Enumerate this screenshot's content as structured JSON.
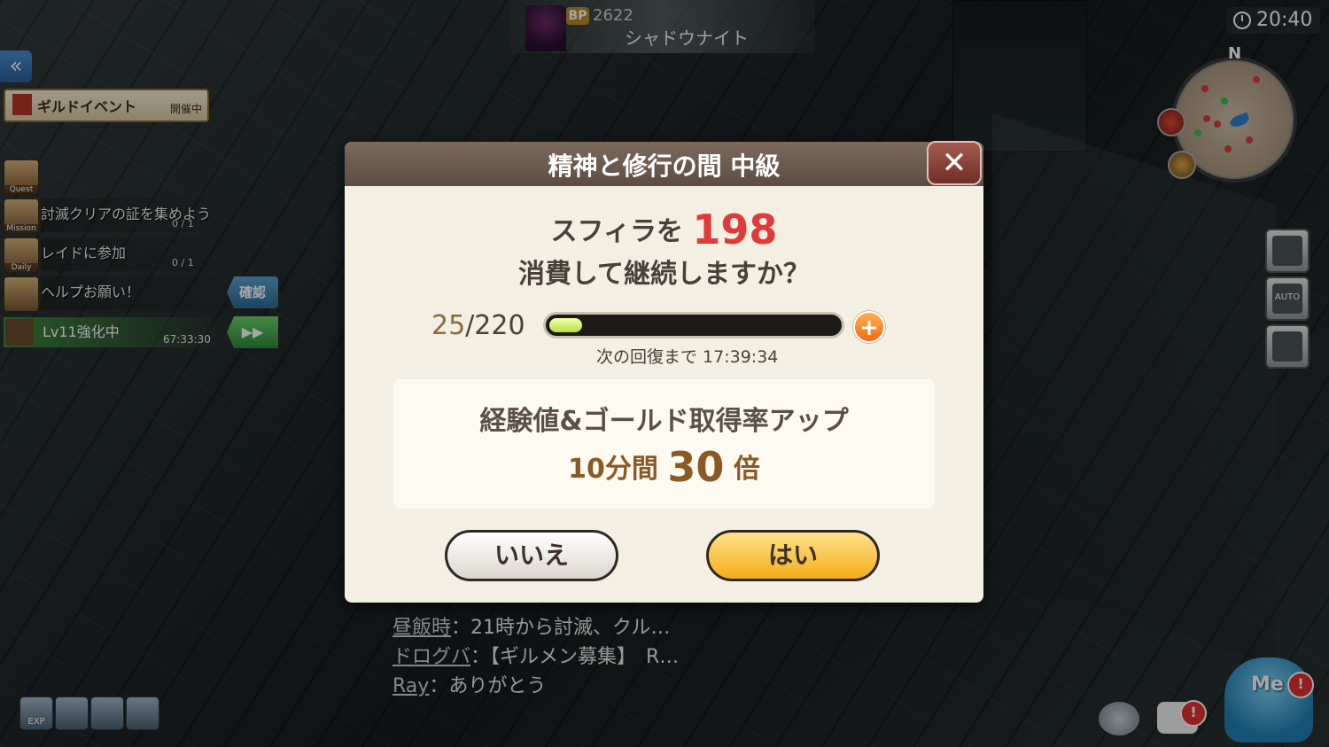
{
  "hud": {
    "target": {
      "bp_label": "BP",
      "bp_value": "2622",
      "name": "シャドウナイト"
    },
    "clock": "20:40",
    "minimap": {
      "north_label": "N"
    }
  },
  "left_panel": {
    "guild_event": {
      "label": "ギルドイベント",
      "status": "開催中"
    },
    "quests": [
      {
        "icon_label": "Quest",
        "text": "",
        "progress": ""
      },
      {
        "icon_label": "Mission",
        "text": "討滅クリアの証を集めよう",
        "progress": "0 / 1"
      },
      {
        "icon_label": "Daily",
        "text": "レイドに参加",
        "progress": "0 / 1"
      },
      {
        "icon_label": "",
        "text": "ヘルプお願い！",
        "progress": ""
      }
    ],
    "confirm_button": "確認",
    "enhance": {
      "text": "Lv11強化中",
      "time": "67:33:30"
    },
    "fast_forward_label": "▶▶"
  },
  "bottom_left_icons": [
    "EXP",
    "",
    "",
    ""
  ],
  "chat": [
    {
      "who": "昼飯時",
      "msg": "：21時から討滅、クル…"
    },
    {
      "who": "ドログバ",
      "msg": "：【ギルメン募集】　R…"
    },
    {
      "who": "Ray",
      "msg": "：ありがとう"
    }
  ],
  "right_panel": {
    "auto_label": "AUTO",
    "me_label": "Me",
    "alert_mark": "!"
  },
  "dialog": {
    "title": "精神と修行の間 中級",
    "close_symbol": "✕",
    "ask_prefix": "スフィラを",
    "cost": "198",
    "ask_line2": "消費して継続しますか？",
    "stamina_current": "25",
    "stamina_sep_max": "/220",
    "stamina_fraction": 0.114,
    "plus_symbol": "+",
    "recovery": "次の回復まで 17:39:34",
    "bonus_line1": "経験値&ゴールド取得率アップ",
    "bonus_prefix": "10分間",
    "bonus_multiplier": "30",
    "bonus_suffix": "倍",
    "no_label": "いいえ",
    "yes_label": "はい"
  },
  "colors": {
    "cost_red": "#e03a3a",
    "yes_gold": "#f4ae1a",
    "header_brown": "#6e5b4f"
  }
}
